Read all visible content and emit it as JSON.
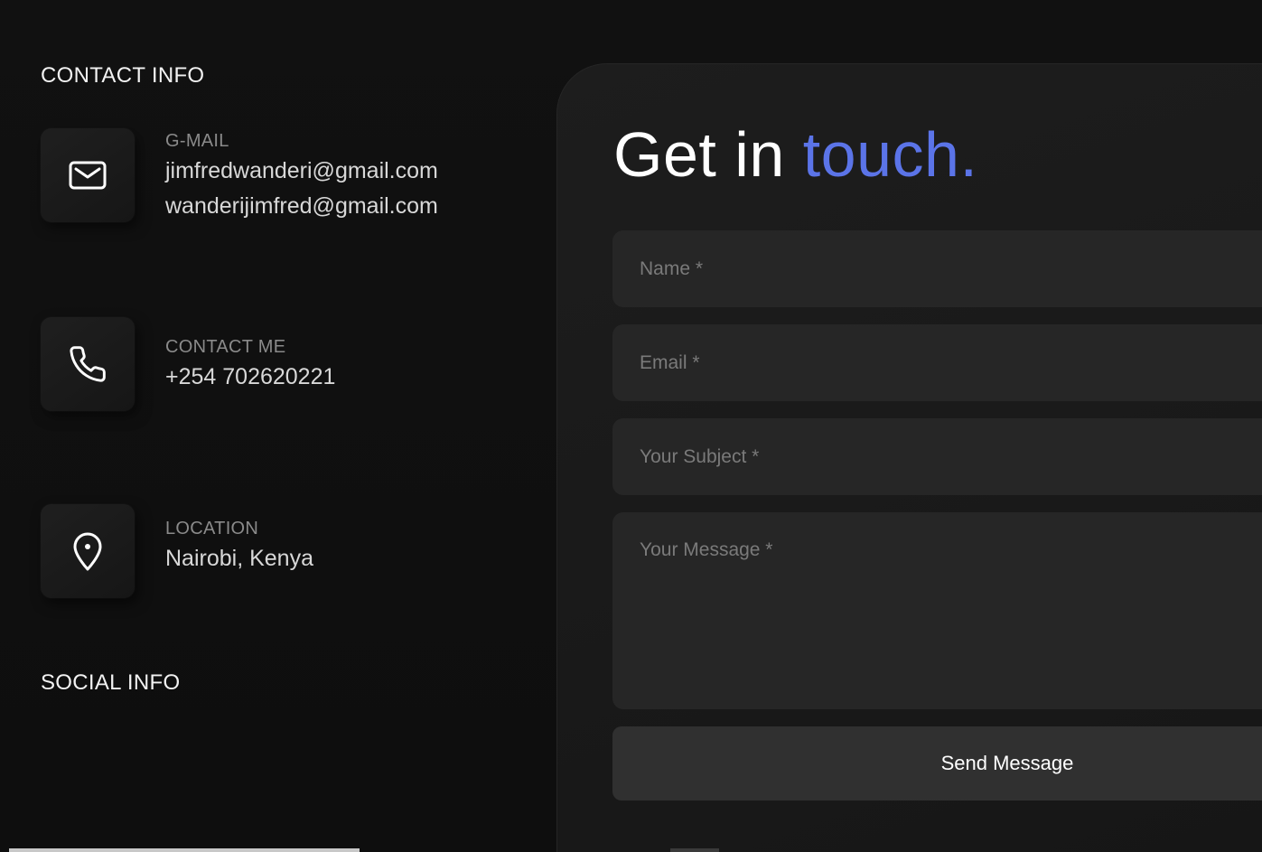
{
  "contact_info": {
    "title": "CONTACT INFO",
    "items": [
      {
        "icon": "mail-icon",
        "label": "G-MAIL",
        "values": [
          "jimfredwanderi@gmail.com",
          "wanderijimfred@gmail.com"
        ]
      },
      {
        "icon": "phone-icon",
        "label": "CONTACT ME",
        "values": [
          "+254 702620221"
        ]
      },
      {
        "icon": "location-pin-icon",
        "label": "LOCATION",
        "values": [
          "Nairobi, Kenya"
        ]
      }
    ]
  },
  "social_info": {
    "title": "SOCIAL INFO"
  },
  "form": {
    "heading_main": "Get in ",
    "heading_accent": "touch.",
    "name_placeholder": "Name *",
    "email_placeholder": "Email *",
    "subject_placeholder": "Your Subject *",
    "message_placeholder": "Your Message *",
    "send_label": "Send Message"
  },
  "colors": {
    "background": "#0f0f0f",
    "card": "#1b1b1b",
    "field": "#262626",
    "button": "#303030",
    "accent": "#5b74e8",
    "label": "#8a8a8a",
    "value": "#d8d8d8"
  }
}
